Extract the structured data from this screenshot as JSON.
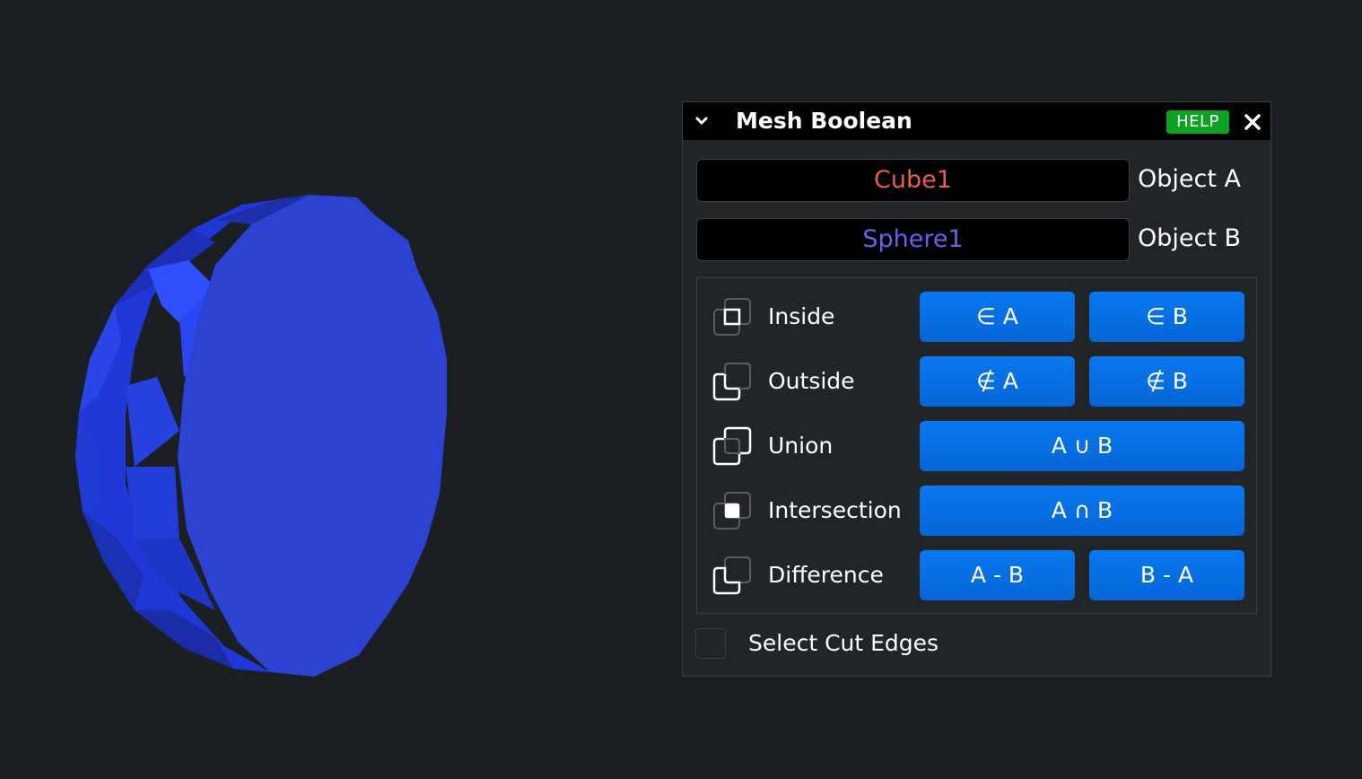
{
  "viewport": {
    "background": "#1b1e22",
    "mesh_color": "#2d43d6"
  },
  "panel": {
    "title": "Mesh Boolean",
    "help_label": "HELP",
    "object_a": {
      "value": "Cube1",
      "label": "Object A",
      "color": "#ec5b5b"
    },
    "object_b": {
      "value": "Sphere1",
      "label": "Object B",
      "color": "#6b5ff0"
    },
    "operations": [
      {
        "label": "Inside",
        "icon": "inside-icon",
        "buttons": [
          "∈ A",
          "∈ B"
        ]
      },
      {
        "label": "Outside",
        "icon": "outside-icon",
        "buttons": [
          "∉ A",
          "∉ B"
        ]
      },
      {
        "label": "Union",
        "icon": "union-icon",
        "buttons": [
          "A ∪ B"
        ]
      },
      {
        "label": "Intersection",
        "icon": "intersection-icon",
        "buttons": [
          "A ∩ B"
        ]
      },
      {
        "label": "Difference",
        "icon": "difference-icon",
        "buttons": [
          "A - B",
          "B - A"
        ]
      }
    ],
    "select_cut_edges": {
      "label": "Select Cut Edges",
      "checked": false
    }
  }
}
